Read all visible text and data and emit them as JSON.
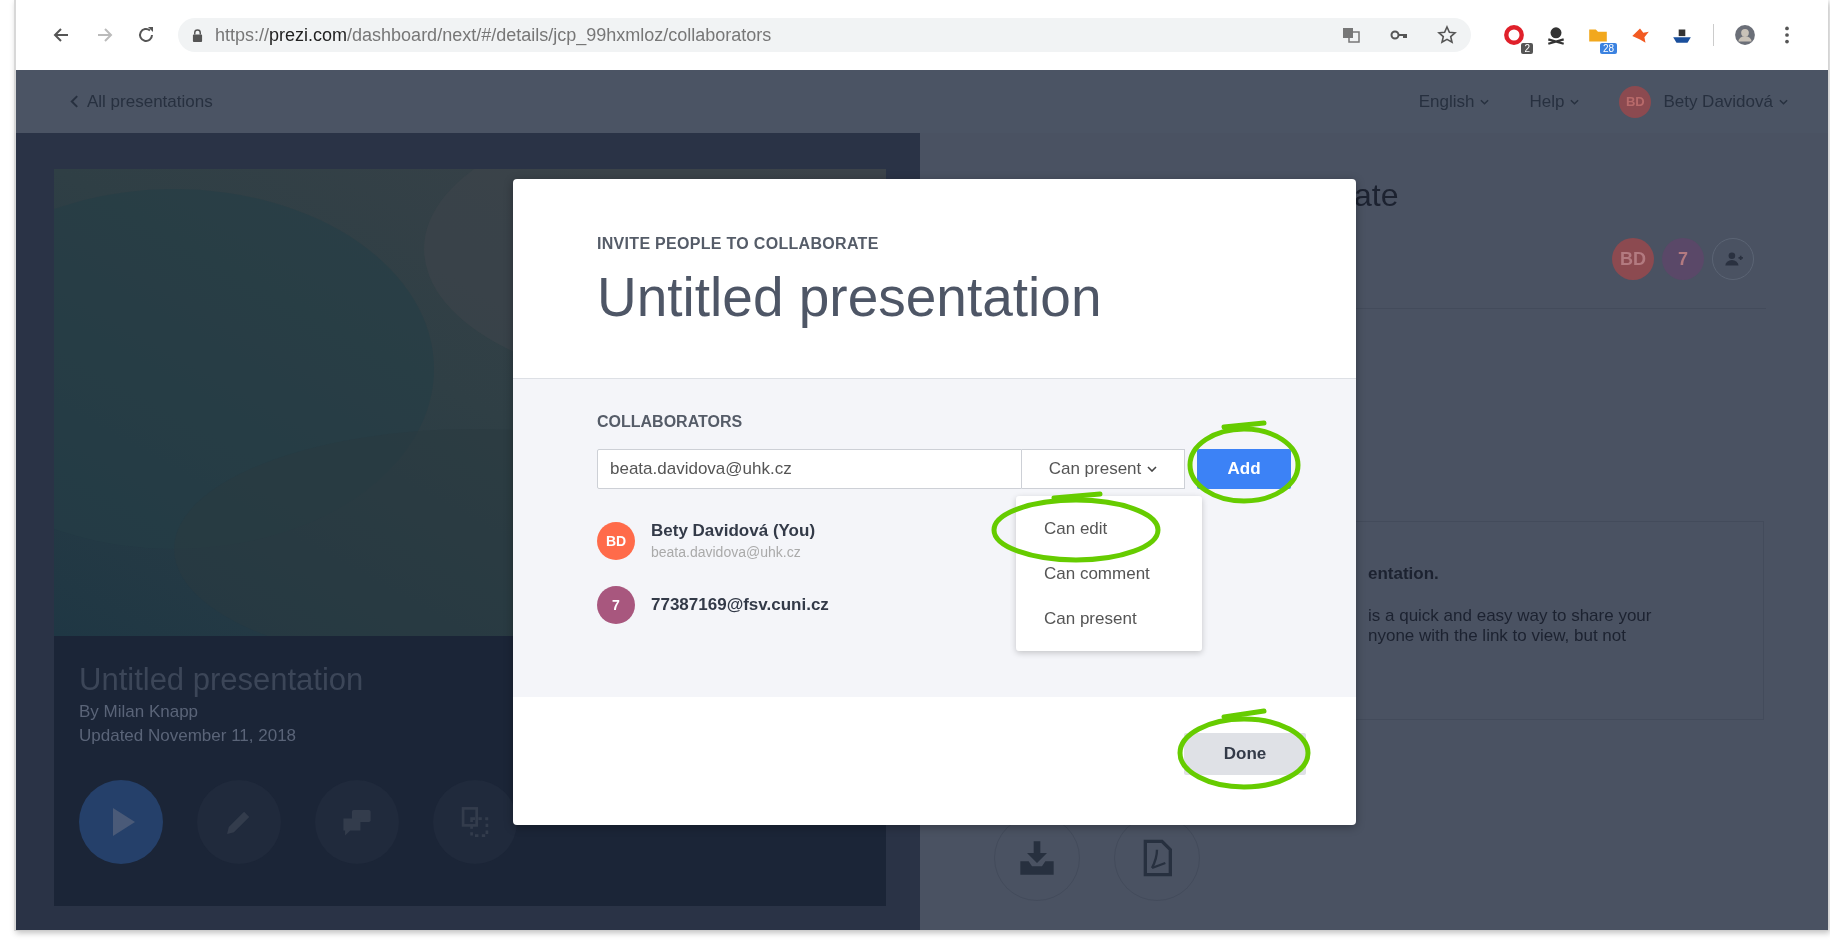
{
  "browser": {
    "url": {
      "scheme": "https://",
      "host": "prezi.com",
      "path": "/dashboard/next/#/details/jcp_99hxmloz/collaborators"
    },
    "extensions": [
      {
        "kind": "opera",
        "badge": "2"
      },
      {
        "kind": "pirate"
      },
      {
        "kind": "folder",
        "badge": "28"
      },
      {
        "kind": "bird"
      },
      {
        "kind": "ship"
      }
    ]
  },
  "header": {
    "back_link": "All presentations",
    "menus": [
      "English",
      "Help"
    ],
    "user": {
      "initials": "BD",
      "name": "Bety Davidová"
    }
  },
  "presentation": {
    "title": "Untitled presentation",
    "author": "By Milan Knapp",
    "updated": "Updated November 11, 2018",
    "actions": [
      {
        "kind": "play"
      },
      {
        "kind": "edit"
      },
      {
        "kind": "comments"
      },
      {
        "kind": "copy"
      }
    ]
  },
  "details": {
    "heading_fragment": "ate",
    "avatars": [
      {
        "initials": "BD",
        "color": "#8c4a50"
      },
      {
        "initials": "7",
        "color": "#5a4868"
      }
    ],
    "notice": {
      "title_fragment": "entation.",
      "lines": [
        "is a quick and easy way to share your",
        "nyone with the link to view, but not"
      ]
    },
    "downloads": [
      {
        "kind": "download"
      },
      {
        "kind": "pdf"
      }
    ]
  },
  "modal": {
    "eyebrow": "INVITE PEOPLE TO COLLABORATE",
    "title": "Untitled presentation",
    "section_label": "COLLABORATORS",
    "email_value": "beata.davidova@uhk.cz",
    "permission": "Can present",
    "add_button": {
      "label": "Add",
      "circled": true
    },
    "options": [
      {
        "label": "Can edit",
        "circled": true
      },
      {
        "label": "Can comment",
        "circled": false
      },
      {
        "label": "Can present",
        "circled": false
      }
    ],
    "collaborators": [
      {
        "initials": "BD",
        "color": "#ff6b4a",
        "name": "Bety Davidová (You)",
        "email": "beata.davidova@uhk.cz"
      },
      {
        "initials": "7",
        "color": "#a8577e",
        "name": "77387169@fsv.cuni.cz"
      }
    ],
    "done_button": {
      "label": "Done",
      "circled": true
    }
  }
}
